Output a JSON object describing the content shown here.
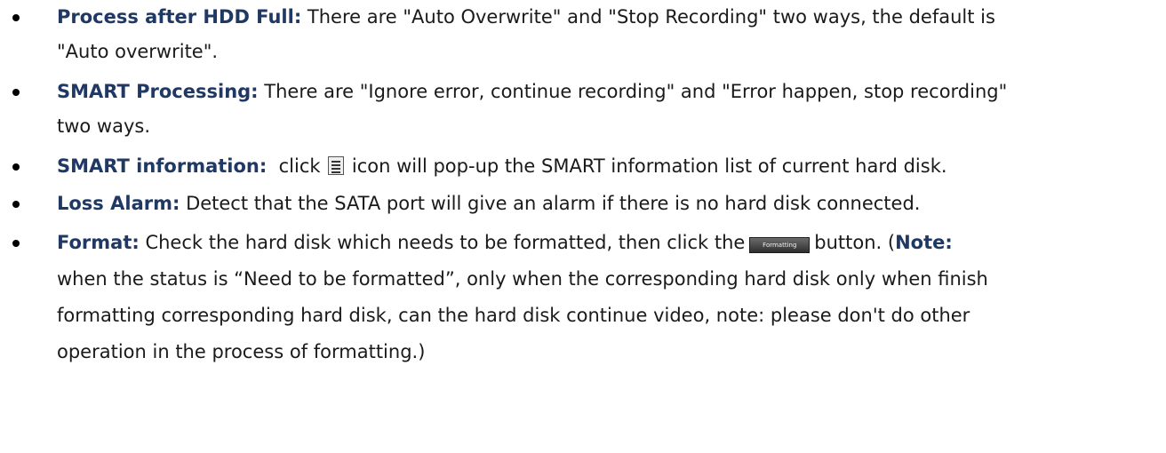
{
  "items": [
    {
      "term": "Process after HDD Full:",
      "line1": " There are \"Auto Overwrite\" and \"Stop Recording\" two ways, the default is",
      "line2": "\"Auto overwrite\"."
    },
    {
      "term": "SMART Processing:",
      "line1": " There are \"Ignore error, continue recording\" and \"Error happen, stop recording\"",
      "line2": "two ways."
    },
    {
      "term": "SMART information:",
      "pre_icon": "  click ",
      "icon": "document-icon",
      "post_icon": " icon will pop-up the SMART information list of current hard disk."
    },
    {
      "term": "Loss Alarm:",
      "text": " Detect that the SATA port will give an alarm if there is no hard disk connected."
    },
    {
      "term": "Format:",
      "pre_button": " Check the hard disk which needs to be formatted, then click the",
      "button_label": "Formatting",
      "post_button": "button. (",
      "note_label": "Note:",
      "line2": "when the status is “Need to be formatted”, only when the corresponding hard disk only when finish",
      "line3": "formatting corresponding hard disk, can the hard disk continue video, note: please don't do other",
      "line4": "operation in the process of formatting.)"
    }
  ]
}
